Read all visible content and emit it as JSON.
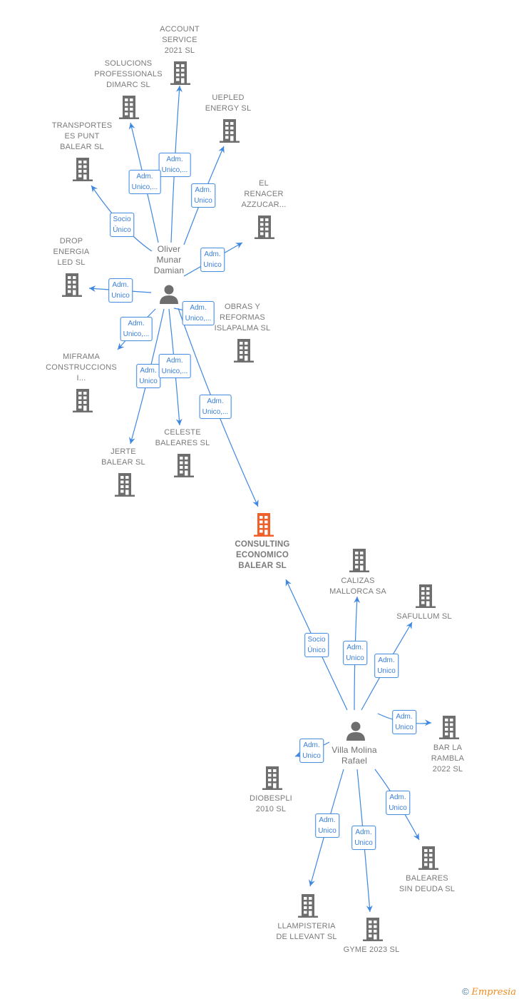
{
  "colors": {
    "focus": "#f0602a",
    "company": "#6e6e6e",
    "person": "#6e6e6e",
    "edge": "#3f87e0"
  },
  "nodes": [
    {
      "id": "account",
      "type": "company",
      "name": "ACCOUNT\nSERVICE\n2021  SL"
    },
    {
      "id": "solucions",
      "type": "company",
      "name": "SOLUCIONS\nPROFESSIONALS\nDIMARC  SL"
    },
    {
      "id": "uepled",
      "type": "company",
      "name": "UEPLED\nENERGY  SL"
    },
    {
      "id": "transportes",
      "type": "company",
      "name": "TRANSPORTES\nES PUNT\nBALEAR  SL"
    },
    {
      "id": "renacer",
      "type": "company",
      "name": "EL\nRENACER\nAZZUCAR..."
    },
    {
      "id": "drop",
      "type": "company",
      "name": "DROP\nENERGIA\nLED  SL"
    },
    {
      "id": "obras",
      "type": "company",
      "name": "OBRAS Y\nREFORMAS\nISLAPALMA  SL"
    },
    {
      "id": "miframa",
      "type": "company",
      "name": "MIFRAMA\nCONSTRUCCIONS\nI..."
    },
    {
      "id": "celeste",
      "type": "company",
      "name": "CELESTE\nBALEARES  SL"
    },
    {
      "id": "jerte",
      "type": "company",
      "name": "JERTE\nBALEAR  SL"
    },
    {
      "id": "consulting",
      "type": "focus",
      "name": "CONSULTING\nECONOMICO\nBALEAR  SL"
    },
    {
      "id": "calizas",
      "type": "company",
      "name": "CALIZAS\nMALLORCA SA"
    },
    {
      "id": "safullum",
      "type": "company",
      "name": "SAFULLUM SL"
    },
    {
      "id": "bar",
      "type": "company",
      "name": "BAR LA\nRAMBLA\n2022  SL"
    },
    {
      "id": "diobespli",
      "type": "company",
      "name": "DIOBESPLI\n2010 SL"
    },
    {
      "id": "baleares",
      "type": "company",
      "name": "BALEARES\nSIN DEUDA  SL"
    },
    {
      "id": "llampisteria",
      "type": "company",
      "name": "LLAMPISTERIA\nDE LLEVANT SL"
    },
    {
      "id": "gyme",
      "type": "company",
      "name": "GYME 2023  SL"
    },
    {
      "id": "oliver",
      "type": "person",
      "name": "Oliver\nMunar\nDamian"
    },
    {
      "id": "villa",
      "type": "person",
      "name": "Villa Molina\nRafael"
    }
  ],
  "edges": [
    {
      "from": "oliver",
      "to": "account",
      "label": "Adm.\nUnico,..."
    },
    {
      "from": "oliver",
      "to": "solucions",
      "label": "Adm.\nUnico,..."
    },
    {
      "from": "oliver",
      "to": "uepled",
      "label": "Adm.\nUnico"
    },
    {
      "from": "oliver",
      "to": "transportes",
      "label": "Socio\nÚnico"
    },
    {
      "from": "oliver",
      "to": "renacer",
      "label": "Adm.\nUnico"
    },
    {
      "from": "oliver",
      "to": "drop",
      "label": "Adm.\nUnico"
    },
    {
      "from": "oliver",
      "to": "miframa",
      "label": "Adm.\nUnico,..."
    },
    {
      "from": "oliver",
      "to": "jerte",
      "label": "Adm.\nUnico"
    },
    {
      "from": "oliver",
      "to": "celeste",
      "label": "Adm.\nUnico,..."
    },
    {
      "from": "oliver",
      "to": "obras",
      "label": "Adm.\nUnico,..."
    },
    {
      "from": "oliver",
      "to": "consulting",
      "label": "Adm.\nUnico,..."
    },
    {
      "from": "villa",
      "to": "consulting",
      "label": "Socio\nÚnico"
    },
    {
      "from": "villa",
      "to": "calizas",
      "label": "Adm.\nUnico"
    },
    {
      "from": "villa",
      "to": "safullum",
      "label": "Adm.\nUnico"
    },
    {
      "from": "villa",
      "to": "bar",
      "label": "Adm.\nUnico"
    },
    {
      "from": "villa",
      "to": "diobespli",
      "label": "Adm.\nUnico"
    },
    {
      "from": "villa",
      "to": "baleares",
      "label": "Adm.\nUnico"
    },
    {
      "from": "villa",
      "to": "llampisteria",
      "label": "Adm.\nUnico"
    },
    {
      "from": "villa",
      "to": "gyme",
      "label": "Adm.\nUnico"
    }
  ],
  "footer": {
    "copyright": "©",
    "brand": "Empresia"
  }
}
